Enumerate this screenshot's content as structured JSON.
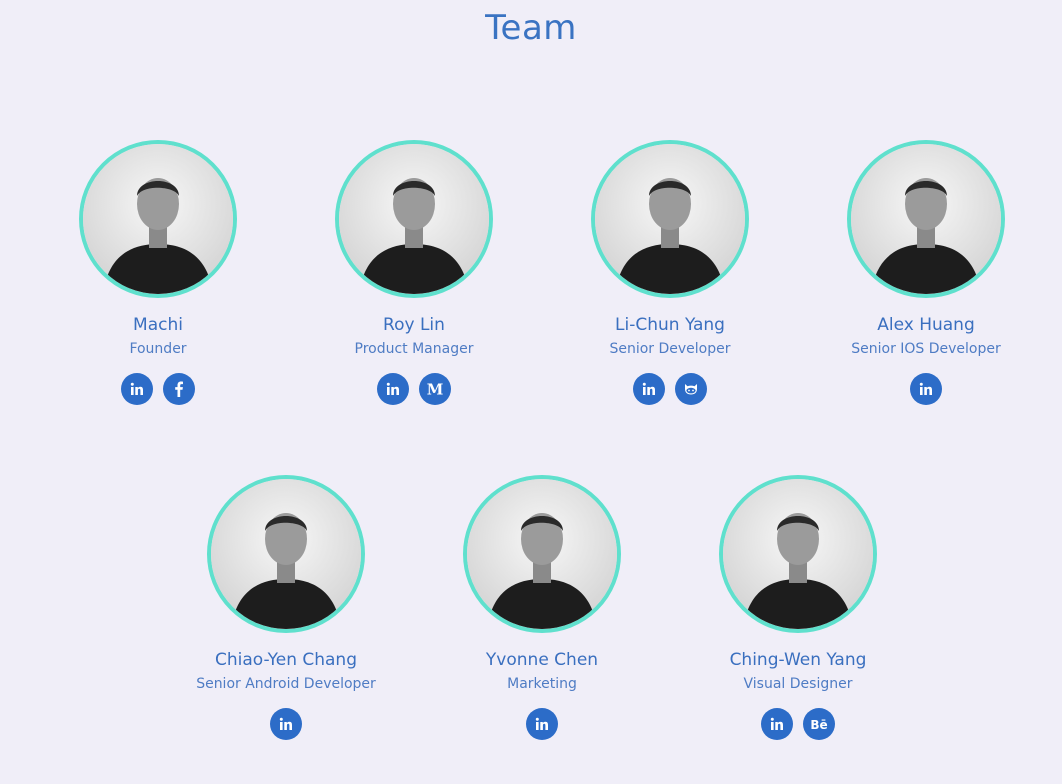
{
  "page": {
    "title": "Team"
  },
  "members": [
    {
      "name": "Machi",
      "role": "Founder",
      "socials": [
        "linkedin-icon",
        "facebook-icon"
      ]
    },
    {
      "name": "Roy Lin",
      "role": "Product Manager",
      "socials": [
        "linkedin-icon",
        "medium-icon"
      ]
    },
    {
      "name": "Li-Chun Yang",
      "role": "Senior Developer",
      "socials": [
        "linkedin-icon",
        "github-icon"
      ]
    },
    {
      "name": "Alex Huang",
      "role": "Senior IOS Developer",
      "socials": [
        "linkedin-icon"
      ]
    },
    {
      "name": "Chiao-Yen Chang",
      "role": "Senior Android Developer",
      "socials": [
        "linkedin-icon"
      ]
    },
    {
      "name": "Yvonne Chen",
      "role": "Marketing",
      "socials": [
        "linkedin-icon"
      ]
    },
    {
      "name": "Ching-Wen Yang",
      "role": "Visual Designer",
      "socials": [
        "linkedin-icon",
        "behance-icon"
      ]
    }
  ],
  "colors": {
    "background": "#f0eef8",
    "accent": "#3a73c2",
    "ring": "#5fe0cd",
    "social_bg": "#2c6cc8"
  }
}
